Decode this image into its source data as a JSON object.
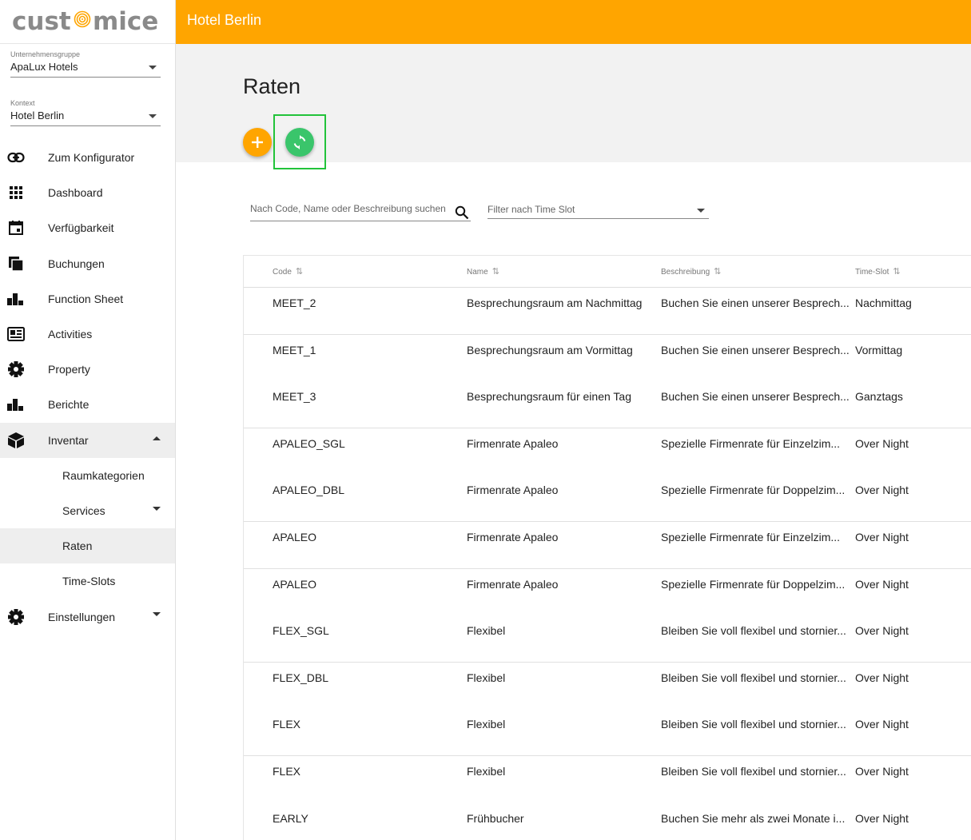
{
  "brand": {
    "logo_text_a": "cust",
    "logo_text_b": "mice"
  },
  "sidebar": {
    "group": {
      "label": "Unternehmensgruppe",
      "value": "ApaLux Hotels"
    },
    "context": {
      "label": "Kontext",
      "value": "Hotel Berlin"
    },
    "items": [
      {
        "label": "Zum Konfigurator",
        "icon": "link-icon"
      },
      {
        "label": "Dashboard",
        "icon": "grid-icon"
      },
      {
        "label": "Verfügbarkeit",
        "icon": "calendar-icon"
      },
      {
        "label": "Buchungen",
        "icon": "copy-icon"
      },
      {
        "label": "Function Sheet",
        "icon": "bar-chart-icon"
      },
      {
        "label": "Activities",
        "icon": "newspaper-icon"
      },
      {
        "label": "Property",
        "icon": "gear-icon"
      },
      {
        "label": "Berichte",
        "icon": "bar-chart-icon"
      },
      {
        "label": "Inventar",
        "icon": "box-icon"
      },
      {
        "label": "Raumkategorien"
      },
      {
        "label": "Services"
      },
      {
        "label": "Raten"
      },
      {
        "label": "Time-Slots"
      },
      {
        "label": "Einstellungen",
        "icon": "gear-icon"
      }
    ]
  },
  "topbar": {
    "title": "Hotel Berlin"
  },
  "page": {
    "title": "Raten"
  },
  "search": {
    "placeholder": "Nach Code, Name oder Beschreibung suchen"
  },
  "filter": {
    "placeholder": "Filter nach Time Slot"
  },
  "table": {
    "columns": [
      "Code",
      "Name",
      "Beschreibung",
      "Time-Slot"
    ],
    "rows": [
      [
        "MEET_2",
        "Besprechungsraum am Nachmittag",
        "Buchen Sie einen unserer Besprech...",
        "Nachmittag"
      ],
      [
        "MEET_1",
        "Besprechungsraum am Vormittag",
        "Buchen Sie einen unserer Besprech...",
        "Vormittag"
      ],
      [
        "MEET_3",
        "Besprechungsraum für einen Tag",
        "Buchen Sie einen unserer Besprech...",
        "Ganztags"
      ],
      [
        "APALEO_SGL",
        "Firmenrate Apaleo",
        "Spezielle Firmenrate für Einzelzim...",
        "Over Night"
      ],
      [
        "APALEO_DBL",
        "Firmenrate Apaleo",
        "Spezielle Firmenrate für Doppelzim...",
        "Over Night"
      ],
      [
        "APALEO",
        "Firmenrate Apaleo",
        "Spezielle Firmenrate für Einzelzim...",
        "Over Night"
      ],
      [
        "APALEO",
        "Firmenrate Apaleo",
        "Spezielle Firmenrate für Doppelzim...",
        "Over Night"
      ],
      [
        "FLEX_SGL",
        "Flexibel",
        "Bleiben Sie voll flexibel und stornier...",
        "Over Night"
      ],
      [
        "FLEX_DBL",
        "Flexibel",
        "Bleiben Sie voll flexibel und stornier...",
        "Over Night"
      ],
      [
        "FLEX",
        "Flexibel",
        "Bleiben Sie voll flexibel und stornier...",
        "Over Night"
      ],
      [
        "FLEX",
        "Flexibel",
        "Bleiben Sie voll flexibel und stornier...",
        "Over Night"
      ],
      [
        "EARLY",
        "Frühbucher",
        "Buchen Sie mehr als zwei Monate i...",
        "Over Night"
      ]
    ]
  },
  "colors": {
    "accent": "#ffa500",
    "sync": "#3ac56b",
    "focus": "#22c33a"
  }
}
